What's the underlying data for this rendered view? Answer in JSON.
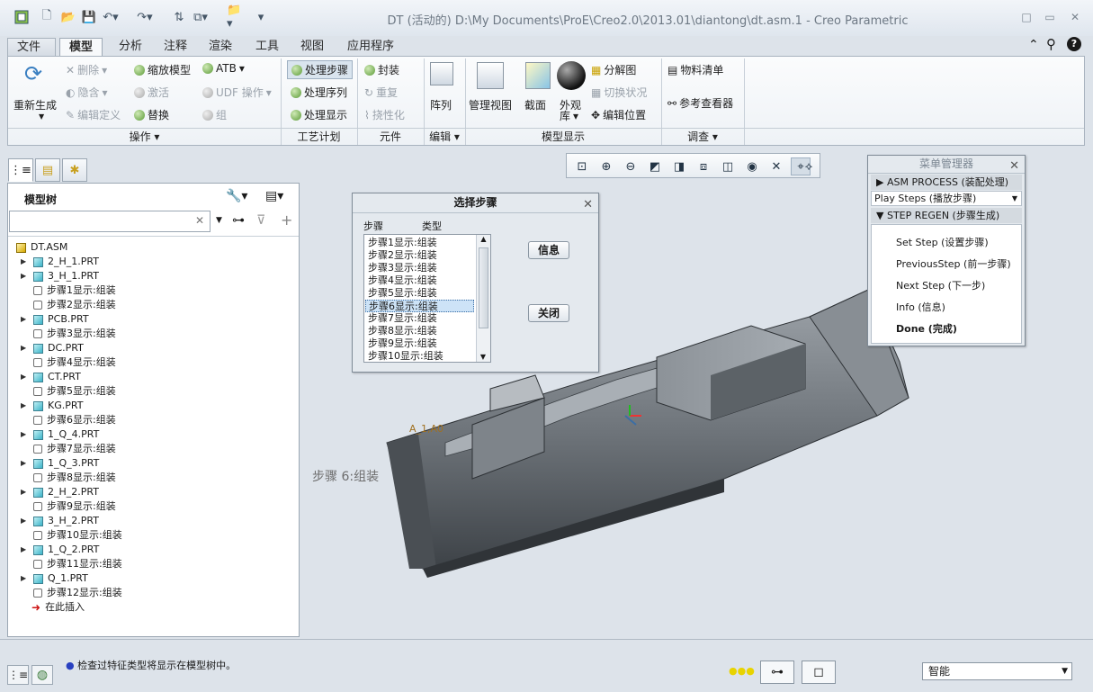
{
  "window": {
    "title": "DT (活动的) D:\\My Documents\\ProE\\Creo2.0\\2013.01\\diantong\\dt.asm.1 - Creo Parametric",
    "controls": [
      "□",
      "▭",
      "✕"
    ]
  },
  "tabs": [
    "文件",
    "模型",
    "分析",
    "注释",
    "渲染",
    "工具",
    "视图",
    "应用程序"
  ],
  "ribbon": {
    "regen": "重新生成",
    "ops": {
      "delete": "删除",
      "hide": "隐含",
      "edit_def": "编辑定义",
      "zoom_model": "缩放模型",
      "activate": "激活",
      "replace": "替换",
      "atb": "ATB",
      "udf": "UDF 操作",
      "group": "组"
    },
    "process": {
      "step": "处理步骤",
      "seq": "处理序列",
      "display": "处理显示"
    },
    "component": {
      "pack": "封装",
      "repeat": "重复",
      "flexible": "挠性化"
    },
    "edit": {
      "array": "阵列"
    },
    "display": {
      "manage_view": "管理视图",
      "section": "截面",
      "appearance": "外观",
      "appearance2": "库",
      "explode": "分解图",
      "toggle_state": "切换状况",
      "edit_position": "编辑位置"
    },
    "investigate": {
      "bom": "物料清单",
      "ref_viewer": "参考查看器"
    },
    "groups": {
      "ops": "操作",
      "process": "工艺计划",
      "component": "元件",
      "edit": "编辑",
      "display": "模型显示",
      "investigate": "调查"
    }
  },
  "model_tree": {
    "title": "模型树",
    "root": "DT.ASM",
    "items": [
      {
        "label": "2_H_1.PRT",
        "type": "part"
      },
      {
        "label": "3_H_1.PRT",
        "type": "part"
      },
      {
        "label": "步骤1显示:组装",
        "type": "feat"
      },
      {
        "label": "步骤2显示:组装",
        "type": "feat"
      },
      {
        "label": "PCB.PRT",
        "type": "part"
      },
      {
        "label": "步骤3显示:组装",
        "type": "feat"
      },
      {
        "label": "DC.PRT",
        "type": "part"
      },
      {
        "label": "步骤4显示:组装",
        "type": "feat"
      },
      {
        "label": "CT.PRT",
        "type": "part"
      },
      {
        "label": "步骤5显示:组装",
        "type": "feat"
      },
      {
        "label": "KG.PRT",
        "type": "part"
      },
      {
        "label": "步骤6显示:组装",
        "type": "feat"
      },
      {
        "label": "1_Q_4.PRT",
        "type": "part"
      },
      {
        "label": "步骤7显示:组装",
        "type": "feat"
      },
      {
        "label": "1_Q_3.PRT",
        "type": "part"
      },
      {
        "label": "步骤8显示:组装",
        "type": "feat"
      },
      {
        "label": "2_H_2.PRT",
        "type": "part"
      },
      {
        "label": "步骤9显示:组装",
        "type": "feat"
      },
      {
        "label": "3_H_2.PRT",
        "type": "part"
      },
      {
        "label": "步骤10显示:组装",
        "type": "feat"
      },
      {
        "label": "1_Q_2.PRT",
        "type": "part"
      },
      {
        "label": "步骤11显示:组装",
        "type": "feat"
      },
      {
        "label": "Q_1.PRT",
        "type": "part"
      },
      {
        "label": "步骤12显示:组装",
        "type": "feat"
      },
      {
        "label": "在此插入",
        "type": "insert"
      }
    ]
  },
  "select_step_dialog": {
    "title": "选择步骤",
    "col_step": "步骤",
    "col_type": "类型",
    "items": [
      "步骤1显示:组装",
      "步骤2显示:组装",
      "步骤3显示:组装",
      "步骤4显示:组装",
      "步骤5显示:组装",
      "步骤6显示:组装",
      "步骤7显示:组装",
      "步骤8显示:组装",
      "步骤9显示:组装",
      "步骤10显示:组装"
    ],
    "selected_index": 5,
    "info_btn": "信息",
    "close_btn": "关闭"
  },
  "menu_manager": {
    "title": "菜单管理器",
    "asm_process": "ASM PROCESS (装配处理)",
    "play_steps": "Play Steps (播放步骤)",
    "step_regen": "STEP REGEN (步骤生成)",
    "items": [
      "Set Step (设置步骤)",
      "PreviousStep (前一步骤)",
      "Next Step (下一步)",
      "Info (信息)",
      "Done (完成)"
    ]
  },
  "viewport": {
    "step_label": "步骤 6:组装",
    "note": "A_1,A0"
  },
  "status": {
    "message": "检查过特征类型将显示在模型树中。",
    "filter": "智能"
  },
  "colors": {
    "accent": "#3b6ea5",
    "model": "#6f747a"
  }
}
